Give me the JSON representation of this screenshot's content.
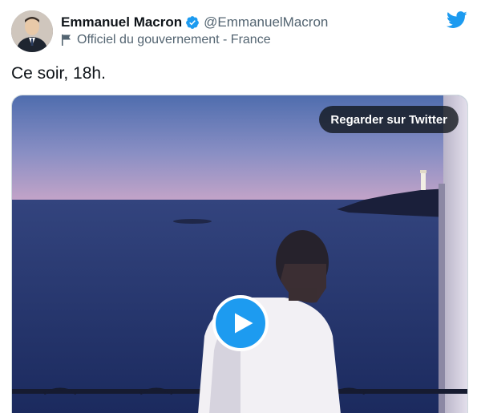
{
  "author": {
    "display_name": "Emmanuel Macron",
    "handle": "@EmmanuelMacron",
    "label": "Officiel du gouvernement - France",
    "verified": true
  },
  "tweet": {
    "text": "Ce soir, 18h."
  },
  "media": {
    "watch_button_label": "Regarder sur Twitter"
  },
  "icons": {
    "verified": "verified-badge-icon",
    "label": "flag-icon",
    "brand": "twitter-bird-icon",
    "play": "play-icon"
  },
  "colors": {
    "accent": "#1d9bf0",
    "text": "#0f1419",
    "secondary_text": "#536471"
  }
}
